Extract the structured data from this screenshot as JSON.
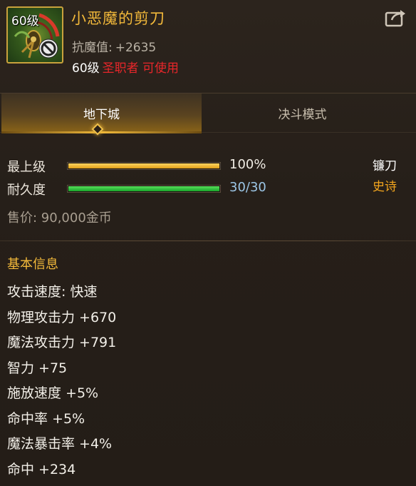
{
  "item": {
    "level_tag": "60级",
    "name": "小恶魔的剪刀",
    "resist_label": "抗魔值:",
    "resist_value": "+2635",
    "req_level": "60级",
    "req_class": "圣职者 可使用"
  },
  "tabs": [
    {
      "label": "地下城",
      "active": true
    },
    {
      "label": "决斗模式",
      "active": false
    }
  ],
  "bars": [
    {
      "label": "最上级",
      "value_text": "100%",
      "fraction": 1.0,
      "color": "#f0b83a"
    },
    {
      "label": "耐久度",
      "value_text": "30/30",
      "fraction": 1.0,
      "color": "#2fc23c"
    }
  ],
  "weapon_type": "镰刀",
  "rarity": "史诗",
  "price": "售价: 90,000金币",
  "basic_info": {
    "title": "基本信息",
    "stats": [
      "攻击速度: 快速",
      "物理攻击力 +670",
      "魔法攻击力 +791",
      "智力 +75",
      "施放速度 +5%",
      "命中率 +5%",
      "魔法暴击率 +4%",
      "命中 +234"
    ]
  },
  "icons": {
    "item": "scissors-weapon-icon",
    "restriction": "ban-icon",
    "share": "share-icon",
    "tab_indicator": "diamond-indicator-icon"
  },
  "colors": {
    "name_gold": "#f3b93a",
    "class_red": "#e8262a",
    "rarity_orange": "#f3a51d",
    "durability_blue": "#9cc6e6"
  }
}
